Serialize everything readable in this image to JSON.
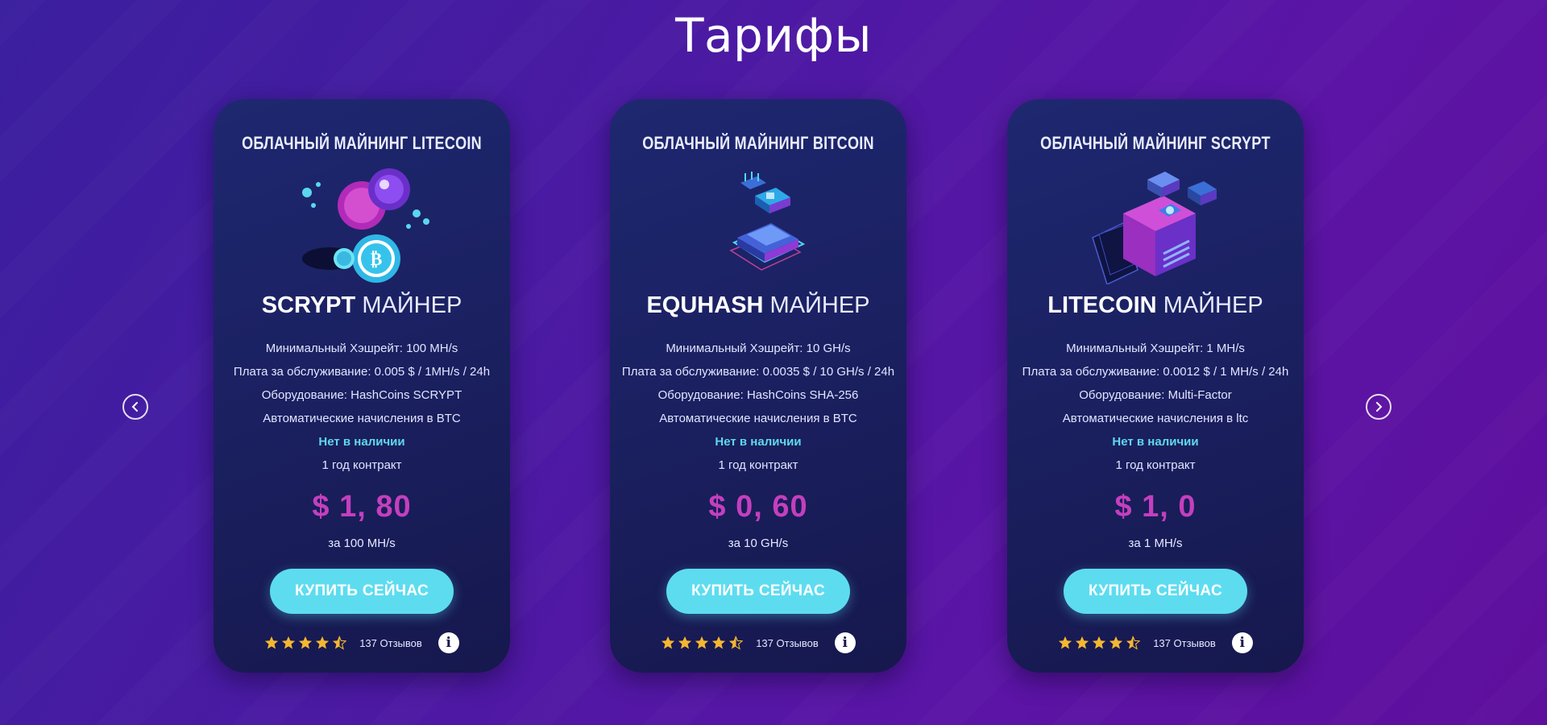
{
  "page": {
    "title": "Тарифы"
  },
  "colors": {
    "accent_price": "#c43fbe",
    "accent_button": "#5ddcf0",
    "stock_text": "#5fd8ea",
    "star": "#f5b731"
  },
  "cards": [
    {
      "heading": "ОБЛАЧНЫЙ МАЙНИНГ LITECOIN",
      "illustration_icon": "coins-bitcoin-icon",
      "miner_bold": "SCRYPT",
      "miner_rest": "МАЙНЕР",
      "spec_hashrate": "Минимальный Хэшрейт: 100 MH/s",
      "spec_fee": "Плата за обслуживание: 0.005 $ / 1MH/s / 24h",
      "spec_hardware": "Оборудование: HashCoins SCRYPT",
      "spec_payout": "Автоматические начисления в BTC",
      "stock": "Нет в наличии",
      "contract": "1 год контракт",
      "price": "$ 1, 80",
      "unit": "за 100 MH/s",
      "buy_label": "КУПИТЬ СЕЙЧАС",
      "rating": 4.5,
      "reviews": "137 Отзывов"
    },
    {
      "heading": "ОБЛАЧНЫЙ МАЙНИНГ BITCOIN",
      "illustration_icon": "chip-blocks-icon",
      "miner_bold": "EQUHASH",
      "miner_rest": "МАЙНЕР",
      "spec_hashrate": "Минимальный Хэшрейт: 10 GH/s",
      "spec_fee": "Плата за обслуживание: 0.0035 $ / 10 GH/s / 24h",
      "spec_hardware": "Оборудование: HashCoins SHA-256",
      "spec_payout": "Автоматические начисления в BTC",
      "stock": "Нет в наличии",
      "contract": "1 год контракт",
      "price": "$ 0, 60",
      "unit": "за 10 GH/s",
      "buy_label": "КУПИТЬ СЕЙЧАС",
      "rating": 4.5,
      "reviews": "137 Отзывов"
    },
    {
      "heading": "ОБЛАЧНЫЙ МАЙНИНГ SCRYPT",
      "illustration_icon": "cube-miner-icon",
      "miner_bold": "LITECOIN",
      "miner_rest": "МАЙНЕР",
      "spec_hashrate": "Минимальный Хэшрейт: 1 MH/s",
      "spec_fee": "Плата за обслуживание: 0.0012 $ / 1 MH/s / 24h",
      "spec_hardware": "Оборудование: Multi-Factor",
      "spec_payout": "Автоматические начисления в ltc",
      "stock": "Нет в наличии",
      "contract": "1 год контракт",
      "price": "$ 1, 0",
      "unit": "за 1 MH/s",
      "buy_label": "КУПИТЬ СЕЙЧАС",
      "rating": 4.5,
      "reviews": "137 Отзывов"
    }
  ],
  "carousel": {
    "prev_icon": "chevron-left-icon",
    "next_icon": "chevron-right-icon"
  }
}
